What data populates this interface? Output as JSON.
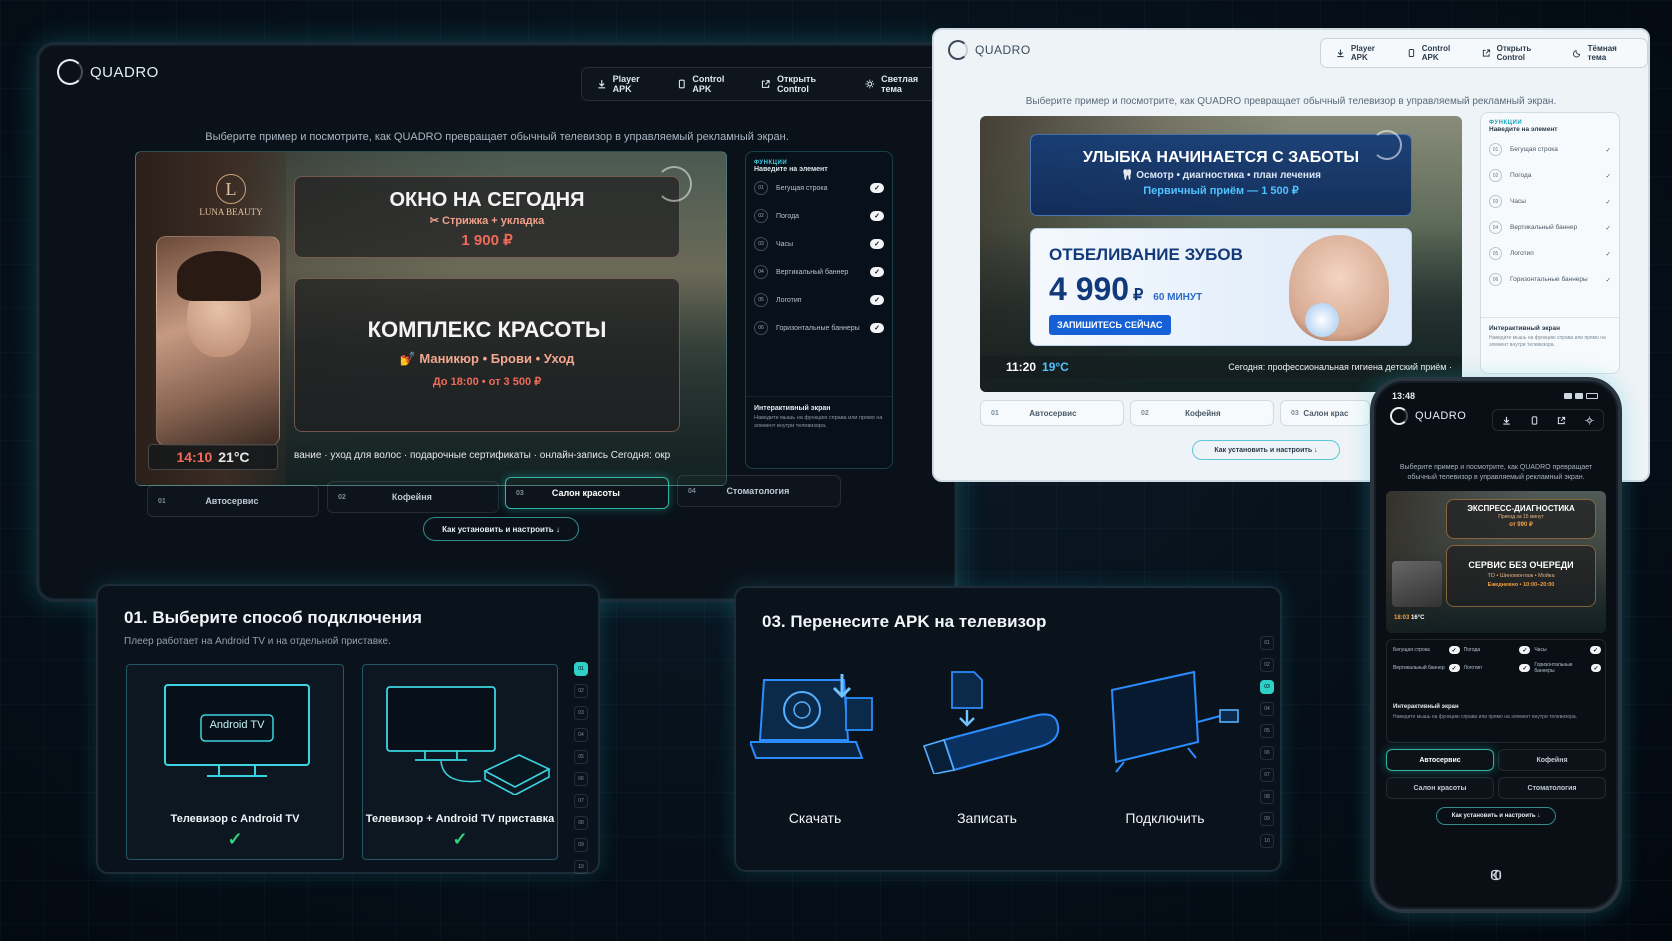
{
  "brand": "QUADRO",
  "dark": {
    "nav": [
      "Player APK",
      "Control APK",
      "Открыть Control",
      "Светлая тема"
    ],
    "caption": "Выберите пример и посмотрите, как QUADRO превращает обычный телевизор в управляемый рекламный экран.",
    "salon_logo": "LUNA BEAUTY",
    "card1": {
      "title": "ОКНО НА СЕГОДНЯ",
      "sub": "✂ Стрижка + укладка",
      "price": "1 900 ₽"
    },
    "card2": {
      "title": "КОМПЛЕКС КРАСОТЫ",
      "sub": "💅 Маникюр • Брови • Уход",
      "price": "До 18:00 • от 3 500 ₽"
    },
    "clock": "14:10",
    "temp": "21°C",
    "ticker": "вание · уход для волос · подарочные сертификаты · онлайн-запись   Сегодня: окр",
    "func_label": "ФУНКЦИИ",
    "func_hint": "Наведите на элемент",
    "funcs": [
      {
        "n": "01",
        "l": "Бегущая строка"
      },
      {
        "n": "02",
        "l": "Погода"
      },
      {
        "n": "03",
        "l": "Часы"
      },
      {
        "n": "04",
        "l": "Вертикальный баннер"
      },
      {
        "n": "05",
        "l": "Логотип"
      },
      {
        "n": "06",
        "l": "Горизонтальные баннеры"
      }
    ],
    "check": "✓",
    "inter_title": "Интерактивный экран",
    "inter_text": "Наведите мышь на функцию справа или прямо на элемент внутри телевизора.",
    "tabs": [
      {
        "n": "01",
        "l": "Автосервис"
      },
      {
        "n": "02",
        "l": "Кофейня"
      },
      {
        "n": "03",
        "l": "Салон красоты"
      },
      {
        "n": "04",
        "l": "Стоматология"
      }
    ],
    "install": "Как установить и настроить ↓"
  },
  "light": {
    "nav": [
      "Player APK",
      "Control APK",
      "Открыть Control",
      "Тёмная тема"
    ],
    "caption": "Выберите пример и посмотрите, как QUADRO превращает обычный телевизор в управляемый рекламный экран.",
    "card1": {
      "title": "УЛЫБКА НАЧИНАЕТСЯ С ЗАБОТЫ",
      "sub": "🦷 Осмотр • диагностика • план лечения",
      "price": "Первичный приём — 1 500 ₽"
    },
    "card2": {
      "title": "ОТБЕЛИВАНИЕ ЗУБОВ",
      "price": "4 990",
      "cur": "₽",
      "dur": "60 МИНУТ",
      "cta": "ЗАПИШИТЕСЬ СЕЙЧАС"
    },
    "clock": "11:20",
    "temp": "19°C",
    "ticker": "Сегодня: профессиональная гигиена детский приём ·",
    "func_label": "ФУНКЦИИ",
    "func_hint": "Наведите на элемент",
    "inter_title": "Интерактивный экран",
    "inter_text": "Наведите мышь на функцию справа или прямо на элемент внутри телевизора.",
    "tabs": [
      {
        "n": "01",
        "l": "Автосервис"
      },
      {
        "n": "02",
        "l": "Кофейня"
      },
      {
        "n": "03",
        "l": "Салон крас"
      }
    ],
    "install": "Как установить и настроить ↓"
  },
  "step1": {
    "title": "01. Выберите способ подключения",
    "sub": "Плеер работает на Android TV и на отдельной приставке.",
    "screen_label": "Android TV",
    "opt1": "Телевизор с Android TV",
    "opt2": "Телевизор + Android TV приставка",
    "steps": [
      "01",
      "02",
      "03",
      "04",
      "05",
      "06",
      "07",
      "08",
      "09",
      "10"
    ]
  },
  "step3": {
    "title": "03. Перенесите APK на телевизор",
    "labels": [
      "Скачать",
      "Записать",
      "Подключить"
    ],
    "steps": [
      "01",
      "02",
      "03",
      "04",
      "05",
      "06",
      "07",
      "08",
      "09",
      "10"
    ]
  },
  "phone": {
    "time": "13:48",
    "caption": "Выберите пример и посмотрите, как QUADRO превращает обычный телевизор в управляемый рекламный экран.",
    "card1": {
      "title": "ЭКСПРЕСС-ДИАГНОСТИКА",
      "sub": "Приезд за 15 минут",
      "price": "от 990 ₽"
    },
    "card2": {
      "title": "СЕРВИС БЕЗ ОЧЕРЕДИ",
      "sub": "ТО • Шиномонтаж • Мойка",
      "price": "Ежедневно • 10:00–20:00"
    },
    "clock": "18:03",
    "temp": "16°C",
    "funcs": [
      "Бегущая строка",
      "Погода",
      "Часы",
      "Вертикальный баннер",
      "Логотип",
      "Горизонтальные баннеры"
    ],
    "inter_title": "Интерактивный экран",
    "inter_text": "Наведите мышь на функцию справа или прямо на элемент внутри телевизора.",
    "tabs": [
      "Автосервис",
      "Кофейня",
      "Салон красоты",
      "Стоматология"
    ],
    "install": "Как установить и настроить ↓"
  }
}
